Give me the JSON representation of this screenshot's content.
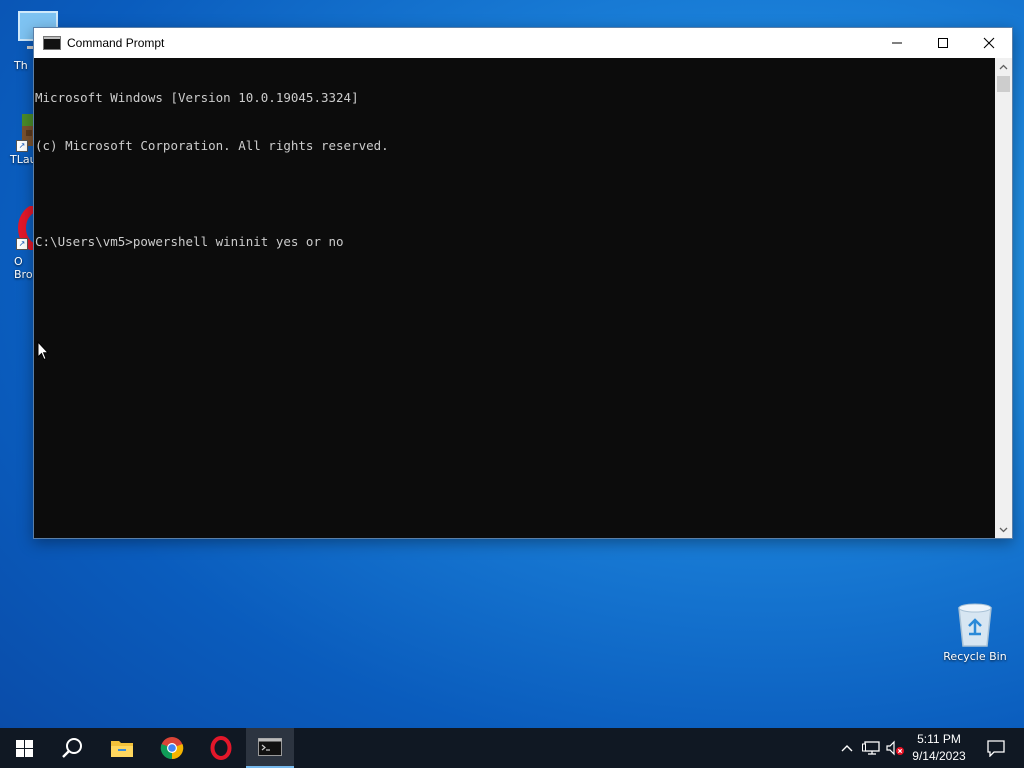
{
  "desktop": {
    "icons": [
      {
        "label": "Th",
        "name": "this-pc"
      },
      {
        "label": "TLau",
        "name": "tlauncher"
      },
      {
        "label": "O\nBro",
        "name": "opera-browser"
      },
      {
        "label": "Recycle Bin",
        "name": "recycle-bin"
      }
    ]
  },
  "window": {
    "title": "Command Prompt",
    "minimize_icon": "minimize-icon",
    "maximize_icon": "maximize-icon",
    "close_icon": "close-icon",
    "console_lines": [
      "Microsoft Windows [Version 10.0.19045.3324]",
      "(c) Microsoft Corporation. All rights reserved.",
      "",
      "C:\\Users\\vm5>powershell wininit yes or no"
    ]
  },
  "taskbar": {
    "apps": [
      "start-icon",
      "search-icon",
      "file-explorer-icon",
      "chrome-icon",
      "opera-icon",
      "command-prompt-icon"
    ],
    "tray_icons": [
      "chevron-up-icon",
      "network-icon",
      "volume-muted-icon",
      "notification-icon"
    ],
    "time": "5:11 PM",
    "date": "9/14/2023"
  },
  "colors": {
    "console_bg": "#0c0c0c",
    "console_text": "#cccccc",
    "taskbar_bg": "#101823",
    "accent": "#76b9ed"
  }
}
